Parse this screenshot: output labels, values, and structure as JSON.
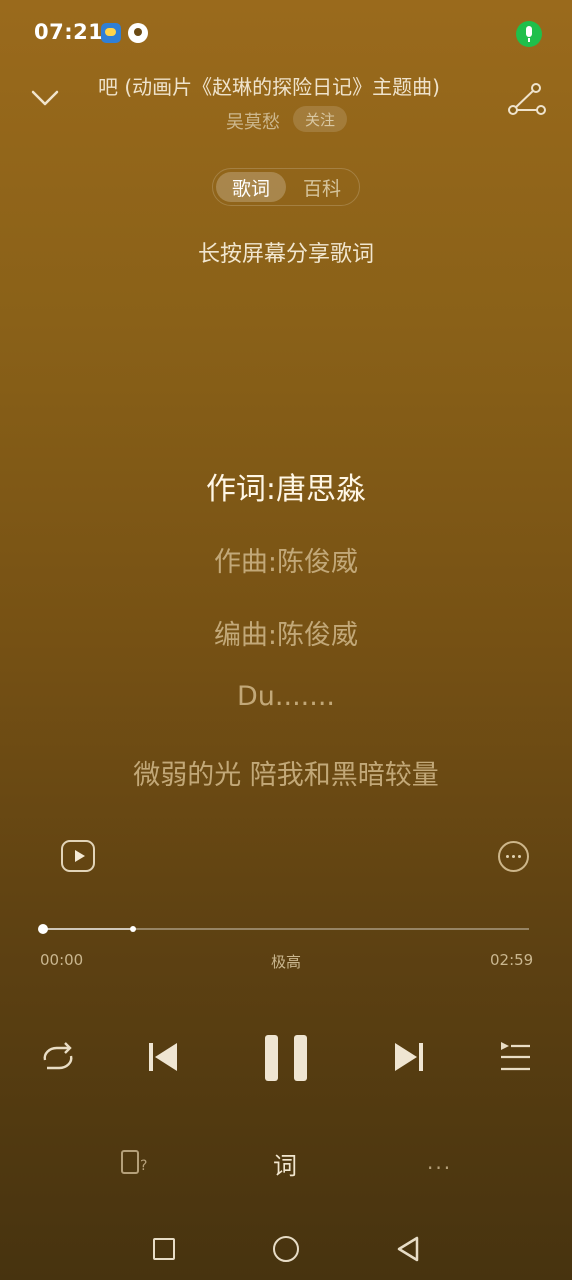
{
  "status_bar": {
    "time": "07:21"
  },
  "header": {
    "song_title": "吧 (动画片《赵琳的探险日记》主题曲)",
    "artist": "吴莫愁",
    "follow_label": "关注"
  },
  "tabs": [
    {
      "label": "歌词",
      "active": true
    },
    {
      "label": "百科",
      "active": false
    }
  ],
  "share_hint": "长按屏幕分享歌词",
  "lyrics": [
    {
      "text": "作词:唐思淼",
      "active": true
    },
    {
      "text": "作曲:陈俊威",
      "active": false
    },
    {
      "text": "编曲:陈俊威",
      "active": false
    },
    {
      "text": "Du.......",
      "active": false
    },
    {
      "text": "微弱的光 陪我和黑暗较量",
      "active": false
    }
  ],
  "progress": {
    "current": "00:00",
    "total": "02:59",
    "quality": "极高",
    "played_fraction": 0.0,
    "buffered_fraction": 0.18
  },
  "controls": {
    "repeat": "repeat-icon",
    "previous": "previous-icon",
    "pause": "pause-icon",
    "next": "next-icon",
    "playlist": "playlist-icon"
  },
  "bottom_bar": {
    "lyric_label": "词",
    "more_label": "···"
  },
  "colors": {
    "accent": "#9a6a1c",
    "text": "#f3ead8"
  }
}
